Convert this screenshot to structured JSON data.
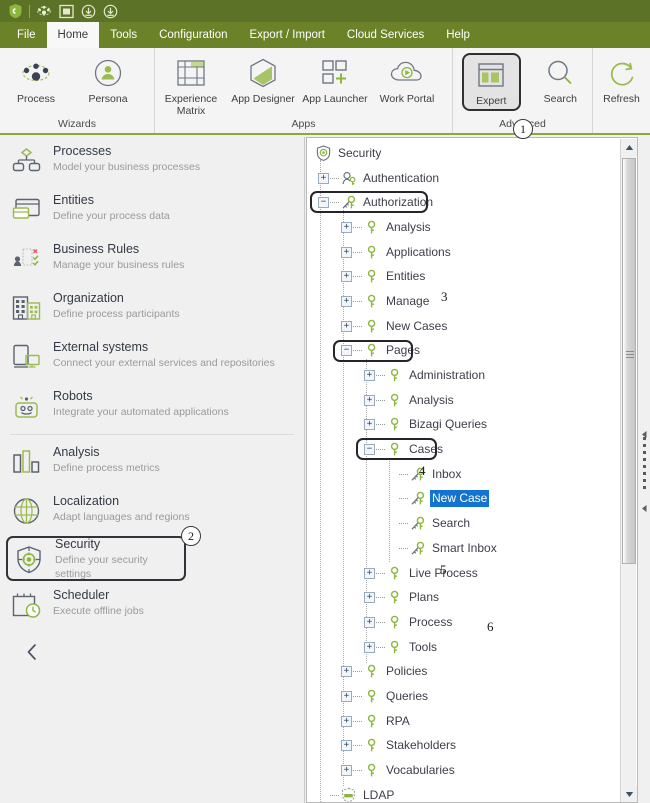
{
  "app": {
    "titlebar_icons": [
      "bizagi-logo-icon",
      "process-nav-icon",
      "window-icon",
      "download-icon",
      "download-alt-icon"
    ]
  },
  "menubar": {
    "items": [
      {
        "label": "File",
        "active": false
      },
      {
        "label": "Home",
        "active": true
      },
      {
        "label": "Tools",
        "active": false
      },
      {
        "label": "Configuration",
        "active": false
      },
      {
        "label": "Export / Import",
        "active": false
      },
      {
        "label": "Cloud Services",
        "active": false
      },
      {
        "label": "Help",
        "active": false
      }
    ]
  },
  "ribbon": {
    "groups": [
      {
        "name": "Wizards",
        "label": "Wizards",
        "buttons": [
          {
            "label": "Process",
            "icon": "process-network-icon",
            "boxed": false
          },
          {
            "label": "Persona",
            "icon": "persona-icon",
            "boxed": false
          }
        ]
      },
      {
        "name": "Apps",
        "label": "Apps",
        "buttons": [
          {
            "label": "Experience Matrix",
            "icon": "experience-matrix-icon",
            "boxed": false
          },
          {
            "label": "App Designer",
            "icon": "app-designer-icon",
            "boxed": false
          },
          {
            "label": "App Launcher",
            "icon": "app-launcher-icon",
            "boxed": false
          },
          {
            "label": "Work Portal",
            "icon": "work-portal-icon",
            "boxed": false
          }
        ]
      },
      {
        "name": "Advanced",
        "label": "Advanced",
        "buttons": [
          {
            "label": "Expert",
            "icon": "expert-icon",
            "boxed": true,
            "callout": "1"
          },
          {
            "label": "Search",
            "icon": "search-icon",
            "boxed": false
          }
        ]
      },
      {
        "name": "Refresh",
        "label": "",
        "buttons": [
          {
            "label": "Refresh",
            "icon": "refresh-icon",
            "boxed": false
          }
        ]
      }
    ]
  },
  "sidebar": {
    "items": [
      {
        "title": "Processes",
        "subtitle": "Model your business processes",
        "icon": "processes-icon",
        "boxed": false
      },
      {
        "title": "Entities",
        "subtitle": "Define your process data",
        "icon": "entities-icon",
        "boxed": false
      },
      {
        "title": "Business Rules",
        "subtitle": "Manage your business rules",
        "icon": "business-rules-icon",
        "boxed": false
      },
      {
        "title": "Organization",
        "subtitle": "Define process participants",
        "icon": "organization-icon",
        "boxed": false
      },
      {
        "title": "External systems",
        "subtitle": "Connect your external services and repositories",
        "icon": "external-systems-icon",
        "boxed": false
      },
      {
        "title": "Robots",
        "subtitle": "Integrate your automated applications",
        "icon": "robots-icon",
        "boxed": false
      },
      {
        "title": "Analysis",
        "subtitle": "Define process metrics",
        "icon": "analysis-icon",
        "boxed": false
      },
      {
        "title": "Localization",
        "subtitle": "Adapt languages and regions",
        "icon": "localization-icon",
        "boxed": false
      },
      {
        "title": "Security",
        "subtitle": "Define your security settings",
        "icon": "security-icon",
        "boxed": true,
        "callout": "2"
      },
      {
        "title": "Scheduler",
        "subtitle": "Execute offline jobs",
        "icon": "scheduler-icon",
        "boxed": false
      }
    ],
    "collapse_icon": "chevron-left-icon"
  },
  "tree": {
    "nodes": [
      {
        "label": "Security",
        "level": 0,
        "expander": "none",
        "icon": "security-shield-icon",
        "selected": false
      },
      {
        "label": "Authentication",
        "level": 0,
        "expander": "plus",
        "icon": "authentication-icon",
        "selected": false
      },
      {
        "label": "Authorization",
        "level": 0,
        "expander": "minus",
        "icon": "authorization-key-icon",
        "selected": false,
        "boxed": true,
        "callout": "3"
      },
      {
        "label": "Analysis",
        "level": 1,
        "expander": "plus",
        "icon": "key-icon",
        "selected": false
      },
      {
        "label": "Applications",
        "level": 1,
        "expander": "plus",
        "icon": "key-icon",
        "selected": false
      },
      {
        "label": "Entities",
        "level": 1,
        "expander": "plus",
        "icon": "key-icon",
        "selected": false
      },
      {
        "label": "Manage",
        "level": 1,
        "expander": "plus",
        "icon": "key-icon",
        "selected": false
      },
      {
        "label": "New Cases",
        "level": 1,
        "expander": "plus",
        "icon": "key-icon",
        "selected": false
      },
      {
        "label": "Pages",
        "level": 1,
        "expander": "minus",
        "icon": "key-icon",
        "selected": false,
        "boxed": true,
        "callout": "4"
      },
      {
        "label": "Administration",
        "level": 2,
        "expander": "plus",
        "icon": "key-icon",
        "selected": false
      },
      {
        "label": "Analysis",
        "level": 2,
        "expander": "plus",
        "icon": "key-icon",
        "selected": false
      },
      {
        "label": "Bizagi Queries",
        "level": 2,
        "expander": "plus",
        "icon": "key-icon",
        "selected": false
      },
      {
        "label": "Cases",
        "level": 2,
        "expander": "minus",
        "icon": "key-icon",
        "selected": false,
        "boxed": true,
        "callout": "5"
      },
      {
        "label": "Inbox",
        "level": 3,
        "expander": "leaf",
        "icon": "authorization-key-icon",
        "selected": false
      },
      {
        "label": "New Case",
        "level": 3,
        "expander": "leaf",
        "icon": "authorization-key-icon",
        "selected": true,
        "callout": "6"
      },
      {
        "label": "Search",
        "level": 3,
        "expander": "leaf",
        "icon": "authorization-key-icon",
        "selected": false
      },
      {
        "label": "Smart Inbox",
        "level": 3,
        "expander": "leaf",
        "icon": "authorization-key-icon",
        "selected": false
      },
      {
        "label": "Live Process",
        "level": 2,
        "expander": "plus",
        "icon": "key-icon",
        "selected": false
      },
      {
        "label": "Plans",
        "level": 2,
        "expander": "plus",
        "icon": "key-icon",
        "selected": false
      },
      {
        "label": "Process",
        "level": 2,
        "expander": "plus",
        "icon": "key-icon",
        "selected": false
      },
      {
        "label": "Tools",
        "level": 2,
        "expander": "plus",
        "icon": "key-icon",
        "selected": false
      },
      {
        "label": "Policies",
        "level": 1,
        "expander": "plus",
        "icon": "key-icon",
        "selected": false
      },
      {
        "label": "Queries",
        "level": 1,
        "expander": "plus",
        "icon": "key-icon",
        "selected": false
      },
      {
        "label": "RPA",
        "level": 1,
        "expander": "plus",
        "icon": "key-icon",
        "selected": false
      },
      {
        "label": "Stakeholders",
        "level": 1,
        "expander": "plus",
        "icon": "key-icon",
        "selected": false
      },
      {
        "label": "Vocabularies",
        "level": 1,
        "expander": "plus",
        "icon": "key-icon",
        "selected": false
      },
      {
        "label": "LDAP",
        "level": 0,
        "expander": "leaf",
        "icon": "ldap-shield-icon",
        "selected": false
      }
    ],
    "scrollbar": {
      "up_icon": "scroll-up-arrow-icon",
      "down_icon": "scroll-down-arrow-icon"
    }
  },
  "colors": {
    "titlebar": "#5c7327",
    "menubar": "#6b8228",
    "accent_green": "#8aa83d",
    "selection_blue": "#1274cf",
    "ribbon_bg": "#f4f4f4",
    "sidebar_bg": "#f0f0f0"
  }
}
